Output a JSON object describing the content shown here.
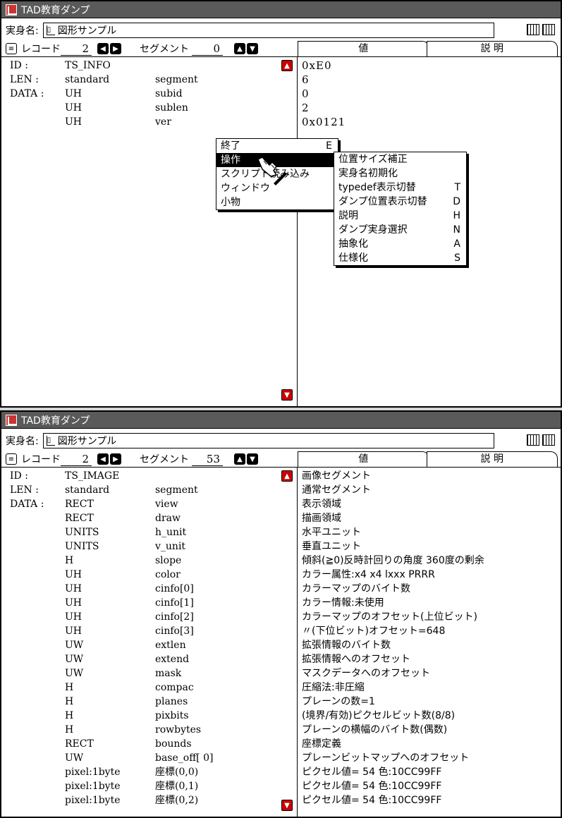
{
  "win1": {
    "title": "TAD教育ダンプ",
    "name_label": "実身名:",
    "name_value": "図形サンプル",
    "record_label": "レコード",
    "record_num": "2",
    "segment_label": "セグメント",
    "segment_num": "0",
    "tab_value": "値",
    "tab_desc": "説 明",
    "rows": [
      {
        "a": "ID  :",
        "b": "TS_INFO",
        "c": ""
      },
      {
        "a": "LEN :",
        "b": "standard",
        "c": "segment"
      },
      {
        "a": "DATA :",
        "b": "UH",
        "c": "subid"
      },
      {
        "a": "",
        "b": "UH",
        "c": "sublen"
      },
      {
        "a": "",
        "b": "UH",
        "c": "ver"
      }
    ],
    "values": [
      "0xE0",
      "6",
      "0",
      "2",
      "0x0121"
    ]
  },
  "menu": {
    "items": [
      {
        "label": "終了",
        "key": "E"
      },
      {
        "label": "操作",
        "key": ""
      },
      {
        "label": "スクリプト読み込み",
        "key": ""
      },
      {
        "label": "ウィンドウ",
        "key": ""
      },
      {
        "label": "小物",
        "key": ""
      }
    ]
  },
  "submenu": {
    "items": [
      {
        "label": "位置サイズ補正",
        "key": ""
      },
      {
        "label": "実身名初期化",
        "key": ""
      },
      {
        "label": "typedef表示切替",
        "key": "T"
      },
      {
        "label": "ダンプ位置表示切替",
        "key": "D"
      },
      {
        "label": "説明",
        "key": "H"
      },
      {
        "label": "ダンプ実身選択",
        "key": "N"
      },
      {
        "label": "抽象化",
        "key": "A"
      },
      {
        "label": "仕様化",
        "key": "S"
      }
    ]
  },
  "win2": {
    "title": "TAD教育ダンプ",
    "name_label": "実身名:",
    "name_value": "図形サンプル",
    "record_label": "レコード",
    "record_num": "2",
    "segment_label": "セグメント",
    "segment_num": "53",
    "tab_value": "値",
    "tab_desc": "説 明",
    "rows": [
      {
        "a": "ID  :",
        "b": "TS_IMAGE",
        "c": ""
      },
      {
        "a": "LEN :",
        "b": "standard",
        "c": "segment"
      },
      {
        "a": "DATA :",
        "b": "RECT",
        "c": "view"
      },
      {
        "a": "",
        "b": "RECT",
        "c": "draw"
      },
      {
        "a": "",
        "b": "UNITS",
        "c": "h_unit"
      },
      {
        "a": "",
        "b": "UNITS",
        "c": "v_unit"
      },
      {
        "a": "",
        "b": "H",
        "c": "slope"
      },
      {
        "a": "",
        "b": "UH",
        "c": "color"
      },
      {
        "a": "",
        "b": "UH",
        "c": "cinfo[0]"
      },
      {
        "a": "",
        "b": "UH",
        "c": "cinfo[1]"
      },
      {
        "a": "",
        "b": "UH",
        "c": "cinfo[2]"
      },
      {
        "a": "",
        "b": "UH",
        "c": "cinfo[3]"
      },
      {
        "a": "",
        "b": "UW",
        "c": "extlen"
      },
      {
        "a": "",
        "b": "UW",
        "c": "extend"
      },
      {
        "a": "",
        "b": "UW",
        "c": "mask"
      },
      {
        "a": "",
        "b": "H",
        "c": "compac"
      },
      {
        "a": "",
        "b": "H",
        "c": "planes"
      },
      {
        "a": "",
        "b": "H",
        "c": "pixbits"
      },
      {
        "a": "",
        "b": "H",
        "c": "rowbytes"
      },
      {
        "a": "",
        "b": "RECT",
        "c": "bounds"
      },
      {
        "a": "",
        "b": "UW",
        "c": "base_off[   0]"
      },
      {
        "a": "",
        "b": "pixel:1byte",
        "c": "座標(0,0)"
      },
      {
        "a": "",
        "b": "pixel:1byte",
        "c": "座標(0,1)"
      },
      {
        "a": "",
        "b": "pixel:1byte",
        "c": "座標(0,2)"
      }
    ],
    "descs": [
      "画像セグメント",
      "通常セグメント",
      "表示領域",
      "描画領域",
      "水平ユニット",
      "垂直ユニット",
      "傾斜(≧0)反時計回りの角度 360度の剰余",
      "カラー属性:x4 x4 lxxx PRRR",
      "カラーマップのバイト数",
      "カラー情報:未使用",
      "カラーマップのオフセット(上位ビット)",
      "〃(下位ビット)オフセット=648",
      "拡張情報のバイト数",
      "拡張情報へのオフセット",
      "マスクデータへのオフセット",
      "圧縮法:非圧縮",
      "プレーンの数=1",
      "(境界/有効)ピクセルビット数(8/8)",
      "プレーンの横幅のバイト数(偶数)",
      "座標定義",
      "プレーンビットマップへのオフセット",
      "ピクセル値= 54 色:10CC99FF",
      "ピクセル値= 54 色:10CC99FF",
      "ピクセル値= 54 色:10CC99FF"
    ]
  }
}
